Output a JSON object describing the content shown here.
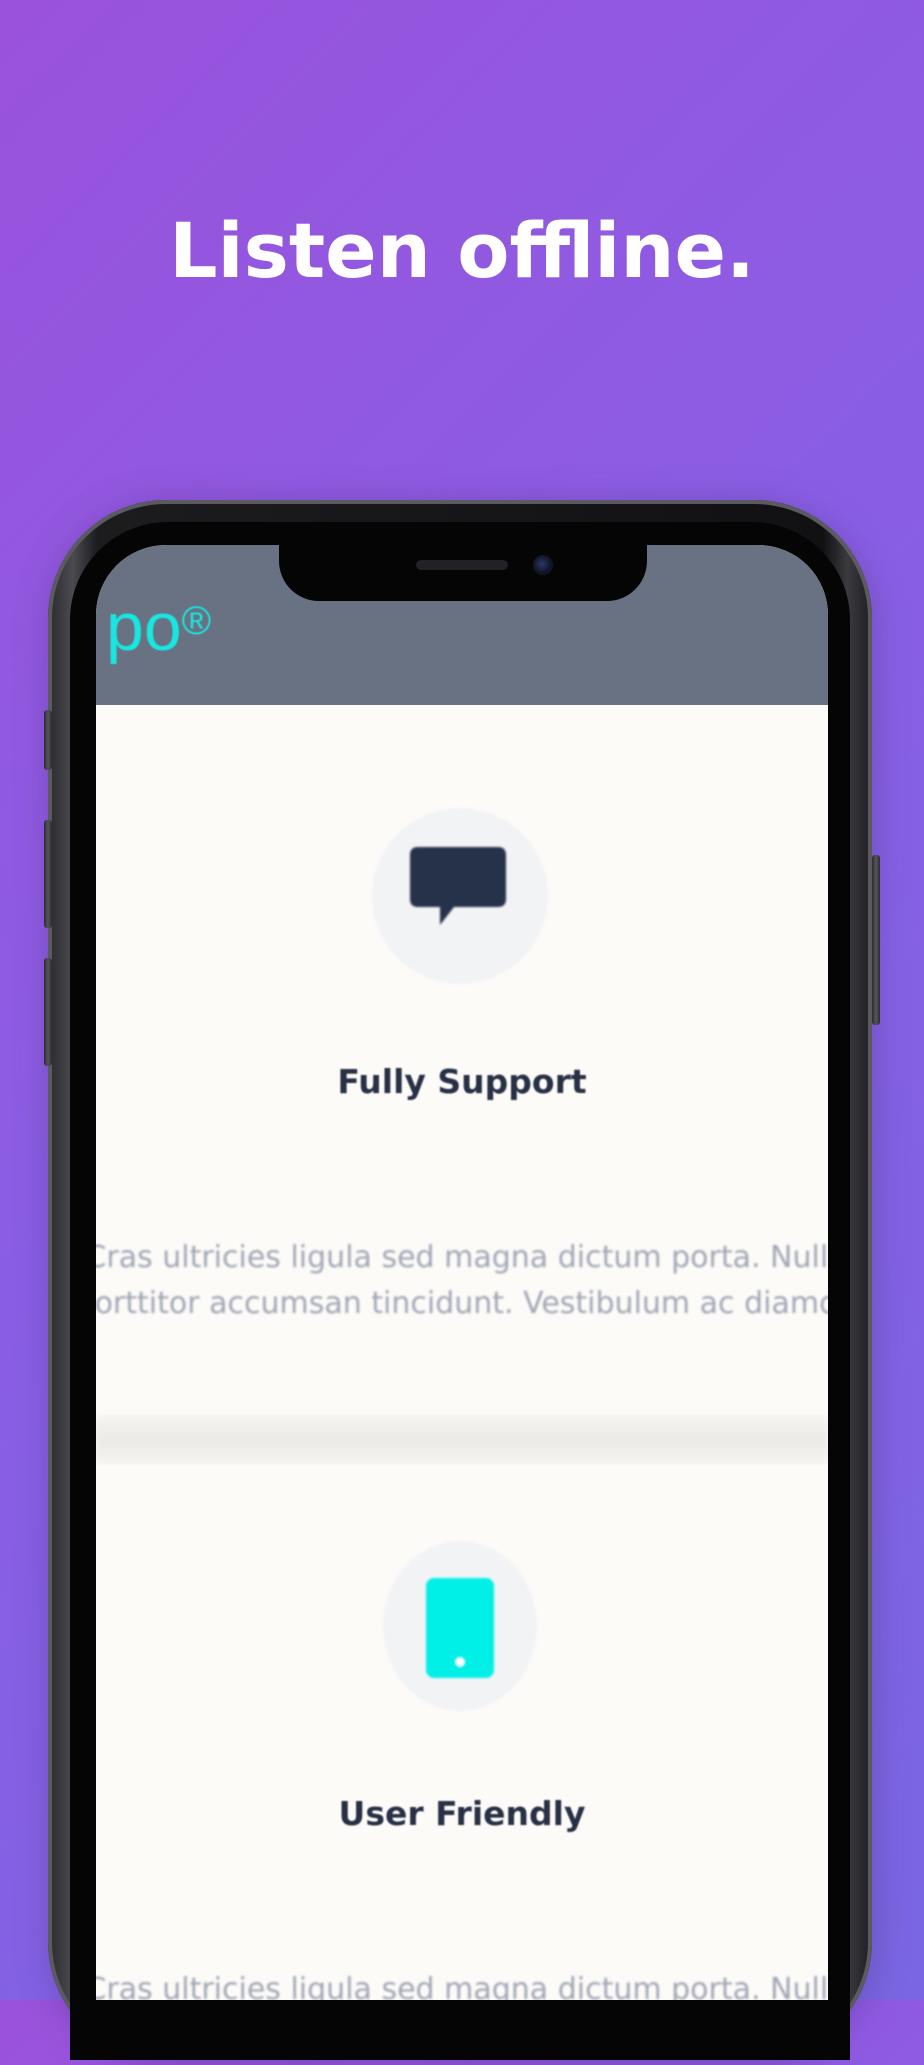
{
  "headline": "Listen offline.",
  "app_bar": {
    "logo_text": "po",
    "logo_mark": "®"
  },
  "features": [
    {
      "icon": "chat-bubble-icon",
      "title": "Fully Support",
      "desc_line_1": "Cras ultricies ligula sed magna dictum porta. Nulla",
      "desc_line_2": "porttitor accumsan tincidunt. Vestibulum ac diamdo"
    },
    {
      "icon": "mobile-phone-icon",
      "title": "User Friendly",
      "desc_line_1": "Cras ultricies ligula sed magna dictum porta. Nulla"
    }
  ],
  "colors": {
    "background_start": "#9a52dc",
    "background_end": "#7a66e2",
    "app_bar": "#687282",
    "accent": "#18e6e0",
    "icon_dark": "#26324a",
    "title_text": "#283045",
    "body_text": "#a1a6b5"
  }
}
